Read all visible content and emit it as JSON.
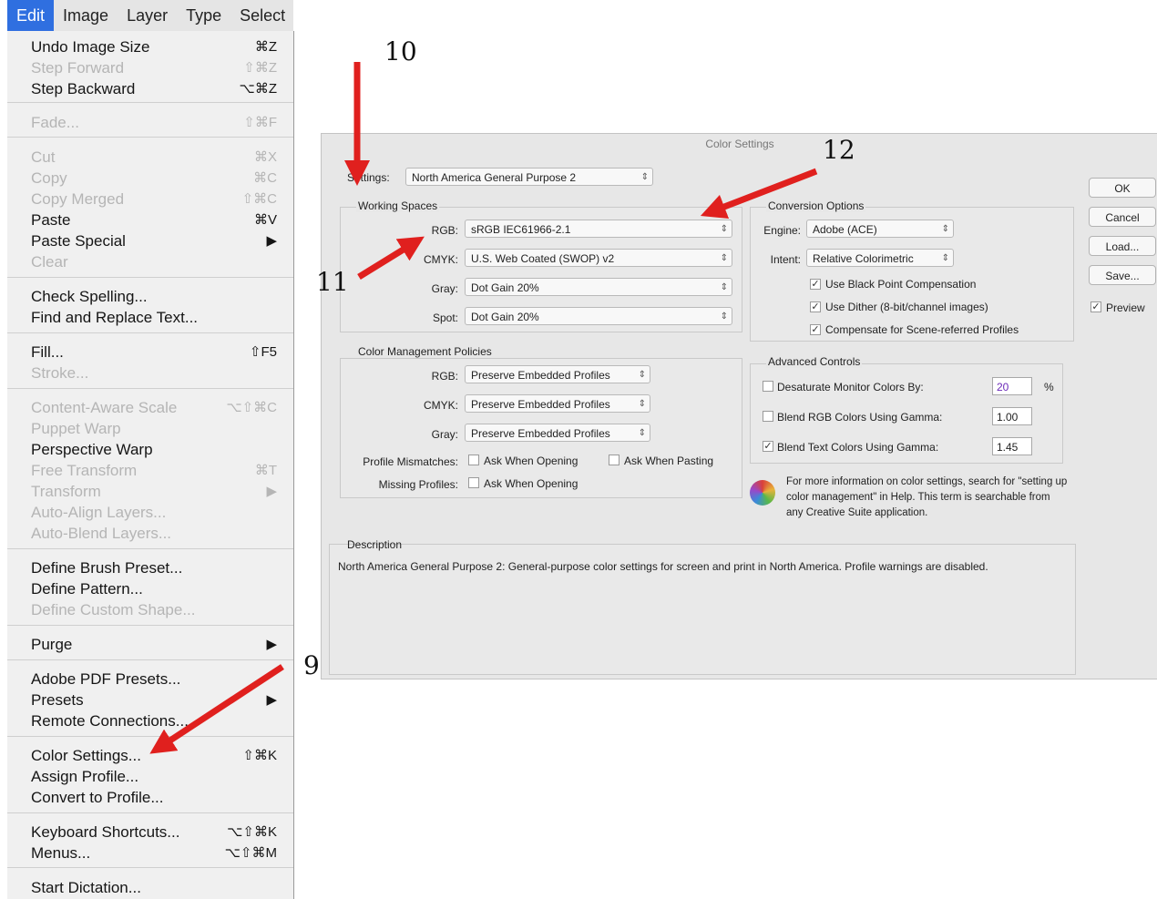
{
  "menubar": {
    "items": [
      "Edit",
      "Image",
      "Layer",
      "Type",
      "Select"
    ]
  },
  "edit_menu": {
    "items": [
      {
        "label": "Undo Image Size",
        "shortcut": "⌘Z",
        "disabled": false
      },
      {
        "label": "Step Forward",
        "shortcut": "⇧⌘Z",
        "disabled": true
      },
      {
        "label": "Step Backward",
        "shortcut": "⌥⌘Z",
        "disabled": false
      },
      {
        "label": "Fade...",
        "shortcut": "⇧⌘F",
        "disabled": true
      },
      {
        "label": "Cut",
        "shortcut": "⌘X",
        "disabled": true
      },
      {
        "label": "Copy",
        "shortcut": "⌘C",
        "disabled": true
      },
      {
        "label": "Copy Merged",
        "shortcut": "⇧⌘C",
        "disabled": true
      },
      {
        "label": "Paste",
        "shortcut": "⌘V",
        "disabled": false
      },
      {
        "label": "Paste Special",
        "shortcut": "▶",
        "disabled": false
      },
      {
        "label": "Clear",
        "shortcut": "",
        "disabled": true
      },
      {
        "label": "Check Spelling...",
        "shortcut": "",
        "disabled": false
      },
      {
        "label": "Find and Replace Text...",
        "shortcut": "",
        "disabled": false
      },
      {
        "label": "Fill...",
        "shortcut": "⇧F5",
        "disabled": false
      },
      {
        "label": "Stroke...",
        "shortcut": "",
        "disabled": true
      },
      {
        "label": "Content-Aware Scale",
        "shortcut": "⌥⇧⌘C",
        "disabled": true
      },
      {
        "label": "Puppet Warp",
        "shortcut": "",
        "disabled": true
      },
      {
        "label": "Perspective Warp",
        "shortcut": "",
        "disabled": false
      },
      {
        "label": "Free Transform",
        "shortcut": "⌘T",
        "disabled": true
      },
      {
        "label": "Transform",
        "shortcut": "▶",
        "disabled": true
      },
      {
        "label": "Auto-Align Layers...",
        "shortcut": "",
        "disabled": true
      },
      {
        "label": "Auto-Blend Layers...",
        "shortcut": "",
        "disabled": true
      },
      {
        "label": "Define Brush Preset...",
        "shortcut": "",
        "disabled": false
      },
      {
        "label": "Define Pattern...",
        "shortcut": "",
        "disabled": false
      },
      {
        "label": "Define Custom Shape...",
        "shortcut": "",
        "disabled": true
      },
      {
        "label": "Purge",
        "shortcut": "▶",
        "disabled": false
      },
      {
        "label": "Adobe PDF Presets...",
        "shortcut": "",
        "disabled": false
      },
      {
        "label": "Presets",
        "shortcut": "▶",
        "disabled": false
      },
      {
        "label": "Remote Connections...",
        "shortcut": "",
        "disabled": false
      },
      {
        "label": "Color Settings...",
        "shortcut": "⇧⌘K",
        "disabled": false
      },
      {
        "label": "Assign Profile...",
        "shortcut": "",
        "disabled": false
      },
      {
        "label": "Convert to Profile...",
        "shortcut": "",
        "disabled": false
      },
      {
        "label": "Keyboard Shortcuts...",
        "shortcut": "⌥⇧⌘K",
        "disabled": false
      },
      {
        "label": "Menus...",
        "shortcut": "⌥⇧⌘M",
        "disabled": false
      },
      {
        "label": "Start Dictation...",
        "shortcut": "",
        "disabled": false
      }
    ]
  },
  "dialog": {
    "title": "Color Settings",
    "settings_label": "Settings:",
    "settings_value": "North America General Purpose 2",
    "working_spaces": {
      "title": "Working Spaces",
      "rgb_label": "RGB:",
      "rgb_value": "sRGB IEC61966-2.1",
      "cmyk_label": "CMYK:",
      "cmyk_value": "U.S. Web Coated (SWOP) v2",
      "gray_label": "Gray:",
      "gray_value": "Dot Gain 20%",
      "spot_label": "Spot:",
      "spot_value": "Dot Gain 20%"
    },
    "conversion": {
      "title": "Conversion Options",
      "engine_label": "Engine:",
      "engine_value": "Adobe (ACE)",
      "intent_label": "Intent:",
      "intent_value": "Relative Colorimetric",
      "black_point": "Use Black Point Compensation",
      "dither": "Use Dither (8-bit/channel images)",
      "compensate": "Compensate for Scene-referred Profiles"
    },
    "policies": {
      "title": "Color Management Policies",
      "rgb_label": "RGB:",
      "rgb_value": "Preserve Embedded Profiles",
      "cmyk_label": "CMYK:",
      "cmyk_value": "Preserve Embedded Profiles",
      "gray_label": "Gray:",
      "gray_value": "Preserve Embedded Profiles",
      "mismatch_label": "Profile Mismatches:",
      "ask_opening": "Ask When Opening",
      "ask_pasting": "Ask When Pasting",
      "missing_label": "Missing Profiles:",
      "ask_opening_missing": "Ask When Opening"
    },
    "advanced": {
      "title": "Advanced Controls",
      "desaturate": "Desaturate Monitor Colors By:",
      "desaturate_value": "20",
      "desaturate_unit": "%",
      "blend_rgb": "Blend RGB Colors Using Gamma:",
      "blend_rgb_value": "1.00",
      "blend_text": "Blend Text Colors Using Gamma:",
      "blend_text_value": "1.45"
    },
    "info_text": "For more information on color settings, search for \"setting up color management\" in Help. This term is searchable from any Creative Suite application.",
    "description": {
      "title": "Description",
      "text": "North America General Purpose 2:  General-purpose color settings for screen and print in North America. Profile warnings are disabled."
    },
    "buttons": {
      "ok": "OK",
      "cancel": "Cancel",
      "load": "Load...",
      "save": "Save...",
      "preview": "Preview"
    }
  },
  "callouts": {
    "n9": "9",
    "n10": "10",
    "n11": "11",
    "n12": "12"
  },
  "colors": {
    "arrow": "#e0201e",
    "menu_highlight": "#2f6fe0"
  }
}
